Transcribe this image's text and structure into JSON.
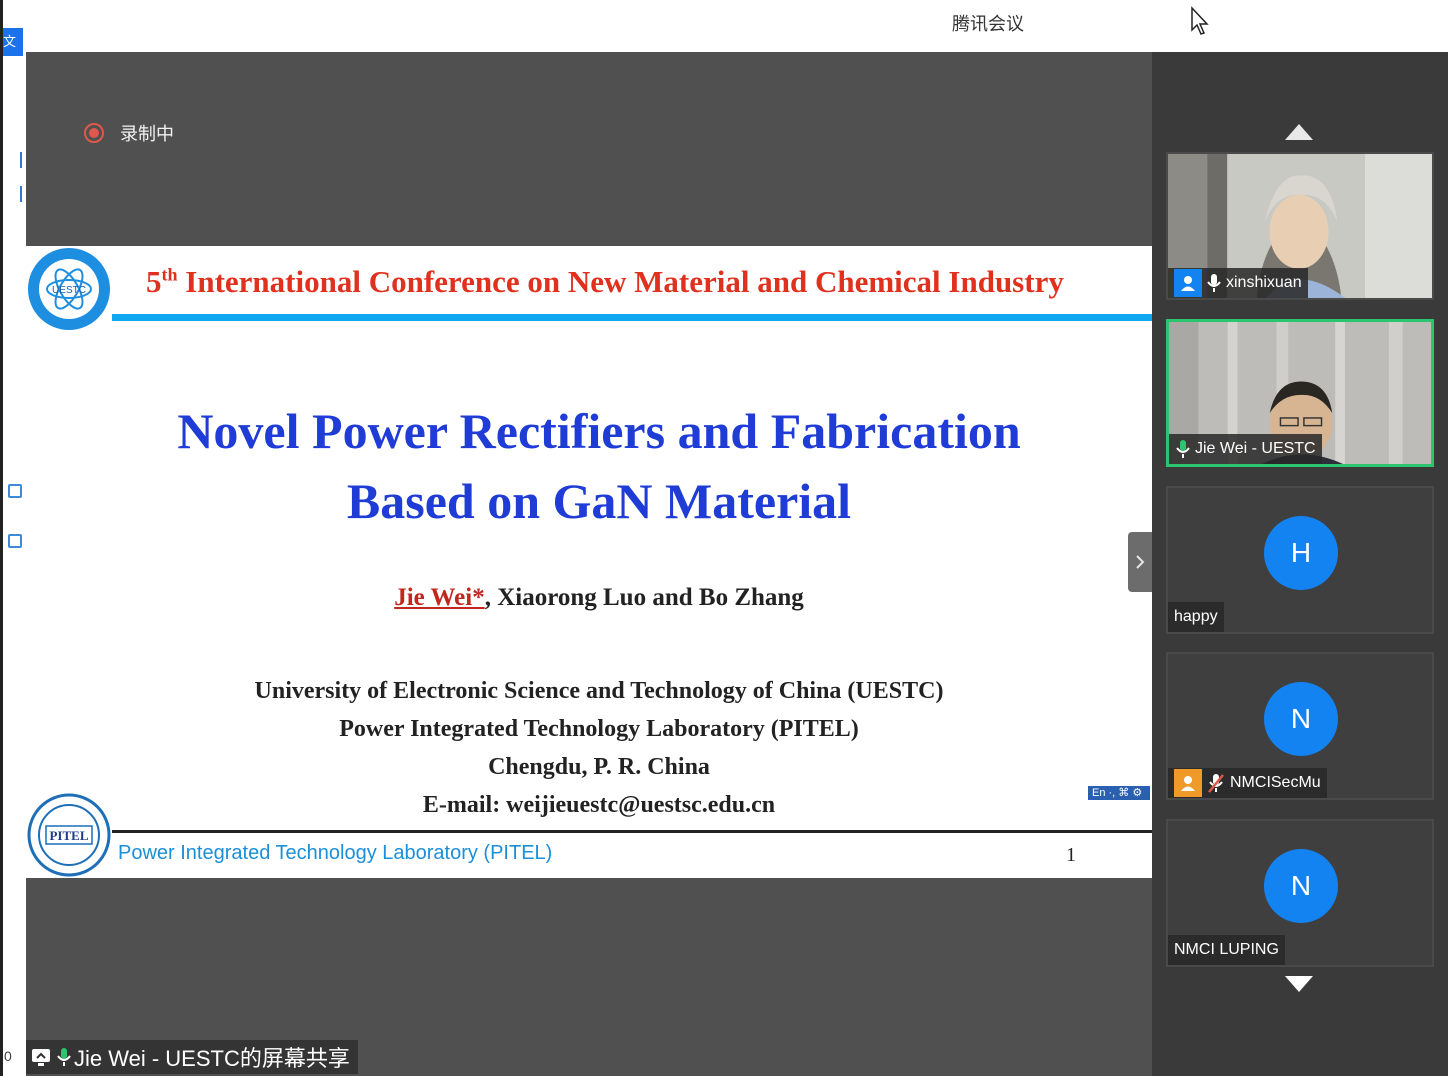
{
  "window": {
    "title": "腾讯会议"
  },
  "desktop": {
    "file_label": "文件",
    "edge_number": "0"
  },
  "recording": {
    "label": "录制中"
  },
  "slide": {
    "conference_prefix": "5",
    "conference_sup": "th",
    "conference_rest": " International Conference on New Material and Chemical Industry",
    "title_line1": "Novel Power Rectifiers and Fabrication",
    "title_line2": "Based on GaN Material",
    "author_main": "Jie Wei*",
    "author_rest": ", Xiaorong Luo and Bo Zhang",
    "affil_1": "University of Electronic Science and Technology of China (UESTC)",
    "affil_2": "Power Integrated Technology Laboratory (PITEL)",
    "affil_3": "Chengdu, P. R. China",
    "affil_4": "E-mail: weijieuestc@uestsc.edu.cn",
    "ime_badge": "En ·, ⌘ ⚙",
    "footer_lab": "Power Integrated Technology Laboratory (PITEL)",
    "page_number": "1",
    "uestc_logo_text": "UESTC",
    "pitel_logo_text": "PITEL"
  },
  "share": {
    "label": "Jie Wei - UESTC的屏幕共享"
  },
  "participants": [
    {
      "name": "xinshixuan",
      "initial": "",
      "video": true,
      "host_badge": true,
      "mic": "on"
    },
    {
      "name": "Jie Wei - UESTC",
      "initial": "",
      "video": true,
      "host_badge": false,
      "mic": "speaking"
    },
    {
      "name": "happy",
      "initial": "H",
      "video": false,
      "host_badge": false,
      "mic": "none"
    },
    {
      "name": "NMCISecMu",
      "initial": "N",
      "video": false,
      "host_badge": true,
      "mic": "muted"
    },
    {
      "name": "NMCI LUPING",
      "initial": "N",
      "video": false,
      "host_badge": false,
      "mic": "none"
    }
  ],
  "colors": {
    "accent_blue": "#1483f2",
    "speaking_green": "#2bc46f",
    "conference_red": "#e0301e",
    "title_blue": "#1f3cd6",
    "stage_gray": "#4f504f"
  }
}
